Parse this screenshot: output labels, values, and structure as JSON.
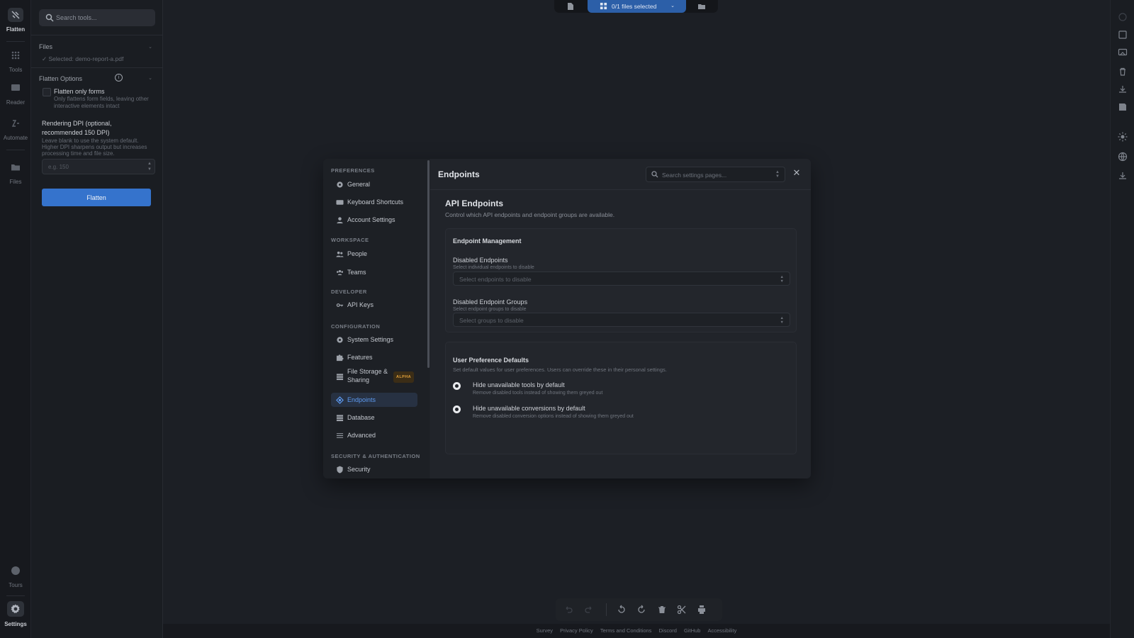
{
  "rail": {
    "items": [
      {
        "label": "Flatten",
        "icon": "flatten-icon"
      },
      {
        "label": "Tools",
        "icon": "grid-icon"
      },
      {
        "label": "Reader",
        "icon": "book-icon"
      },
      {
        "label": "Automate",
        "icon": "automate-icon"
      },
      {
        "label": "Files",
        "icon": "folder-icon"
      },
      {
        "label": "Tours",
        "icon": "compass-icon"
      },
      {
        "label": "Settings",
        "icon": "gear-icon"
      }
    ]
  },
  "tool_panel": {
    "search_placeholder": "Search tools...",
    "files_label": "Files",
    "selected_text": "✓ Selected: demo-report-a.pdf",
    "options_label": "Flatten Options",
    "flatten_only_forms_label": "Flatten only forms",
    "flatten_only_forms_desc_1": "Only flattens form fields, leaving other",
    "flatten_only_forms_desc_2": "interactive elements intact",
    "dpi_label_1": "Rendering DPI (optional,",
    "dpi_label_2": "recommended 150 DPI)",
    "dpi_desc_1": "Leave blank to use the system default.",
    "dpi_desc_2": "Higher DPI sharpens output but increases",
    "dpi_desc_3": "processing time and file size.",
    "dpi_placeholder": "e.g. 150",
    "flatten_button": "Flatten"
  },
  "topbar": {
    "files_selected": "0/1 files selected"
  },
  "settings": {
    "sections": {
      "preferences": "PREFERENCES",
      "workspace": "WORKSPACE",
      "developer": "DEVELOPER",
      "configuration": "CONFIGURATION",
      "security": "SECURITY & AUTHENTICATION"
    },
    "nav": {
      "general": "General",
      "keyboard_shortcuts": "Keyboard Shortcuts",
      "account_settings": "Account Settings",
      "people": "People",
      "teams": "Teams",
      "api_keys": "API Keys",
      "system_settings": "System Settings",
      "features": "Features",
      "file_storage_1": "File Storage &",
      "file_storage_2": "Sharing",
      "alpha_badge": "ALPHA",
      "endpoints": "Endpoints",
      "database": "Database",
      "advanced": "Advanced",
      "security": "Security"
    },
    "page_title": "Endpoints",
    "search_placeholder": "Search settings pages...",
    "close_glyph": "✕",
    "api_title": "API Endpoints",
    "api_desc": "Control which API endpoints and endpoint groups are available.",
    "endpoint_management": {
      "title": "Endpoint Management",
      "disabled_endpoints_label": "Disabled Endpoints",
      "disabled_endpoints_sub": "Select individual endpoints to disable",
      "disabled_endpoints_placeholder": "Select endpoints to disable",
      "disabled_groups_label": "Disabled Endpoint Groups",
      "disabled_groups_sub": "Select endpoint groups to disable",
      "disabled_groups_placeholder": "Select groups to disable"
    },
    "user_preferences": {
      "title": "User Preference Defaults",
      "desc": "Set default values for user preferences. Users can override these in their personal settings.",
      "option1_label": "Hide unavailable tools by default",
      "option1_sub": "Remove disabled tools instead of showing them greyed out",
      "option2_label": "Hide unavailable conversions by default",
      "option2_sub": "Remove disabled conversion options instead of showing them greyed out"
    }
  },
  "footer": {
    "links": [
      "Survey",
      "Privacy Policy",
      "Terms and Conditions",
      "Discord",
      "GitHub",
      "Accessibility"
    ]
  },
  "colors": {
    "accent": "#3573cc",
    "active_nav": "#5d9af0",
    "background": "#1c1f25"
  }
}
